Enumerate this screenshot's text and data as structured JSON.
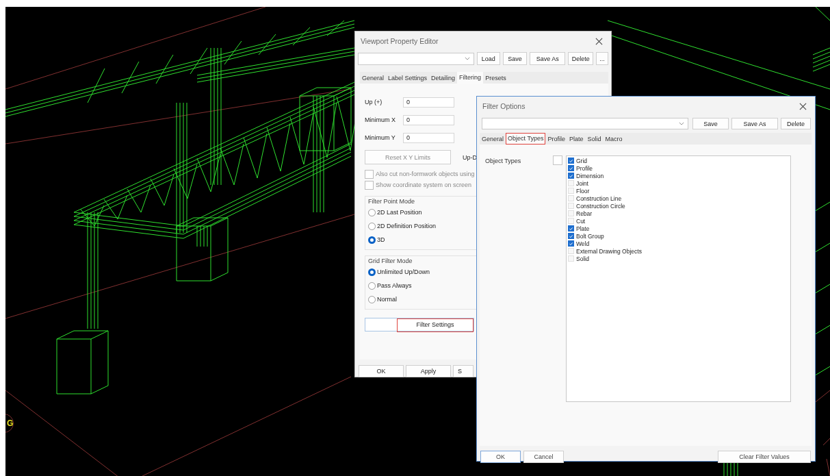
{
  "grid_label": "G",
  "viewport_editor": {
    "title": "Viewport Property Editor",
    "buttons": [
      "Load",
      "Save",
      "Save As",
      "Delete",
      "..."
    ],
    "tabs": [
      {
        "label": "General",
        "selected": false
      },
      {
        "label": "Label Settings",
        "selected": false
      },
      {
        "label": "Detailing",
        "selected": false
      },
      {
        "label": "Filtering",
        "selected": true
      },
      {
        "label": "Presets",
        "selected": false
      }
    ],
    "fields": [
      {
        "label": "Up (+)",
        "value": "0"
      },
      {
        "label": "Minimum X",
        "value": "0"
      },
      {
        "label": "Minimum Y",
        "value": "0"
      }
    ],
    "reset_button": {
      "label": "Reset X Y Limits",
      "disabled": true
    },
    "up_down_label": "Up-D",
    "checkboxes": [
      {
        "label": "Also cut non-formwork objects using",
        "checked": false,
        "disabled": true
      },
      {
        "label": "Show coordinate system on screen",
        "checked": false,
        "disabled": true
      }
    ],
    "groups": [
      {
        "title": "Filter Point Mode",
        "options": [
          {
            "label": "2D Last Position",
            "selected": false
          },
          {
            "label": "2D Definition Position",
            "selected": false
          },
          {
            "label": "3D",
            "selected": true
          }
        ]
      },
      {
        "title": "Grid Filter Mode",
        "options": [
          {
            "label": "Unlimited Up/Down",
            "selected": true
          },
          {
            "label": "Pass Always",
            "selected": false
          },
          {
            "label": "Normal",
            "selected": false
          }
        ]
      }
    ],
    "filter_settings_button": {
      "label": "Filter Settings",
      "highlighted": true
    },
    "footer_buttons": [
      "OK",
      "Apply",
      "S"
    ]
  },
  "filter_options": {
    "title": "Filter Options",
    "buttons": [
      "Save",
      "Save As",
      "Delete"
    ],
    "tabs": [
      {
        "label": "General",
        "selected": false,
        "highlighted": false
      },
      {
        "label": "Object Types",
        "selected": true,
        "highlighted": true
      },
      {
        "label": "Profile",
        "selected": false,
        "highlighted": false
      },
      {
        "label": "Plate",
        "selected": false,
        "highlighted": false
      },
      {
        "label": "Solid",
        "selected": false,
        "highlighted": false
      },
      {
        "label": "Macro",
        "selected": false,
        "highlighted": false
      }
    ],
    "object_types_label": "Object Types",
    "select_all_checked": false,
    "object_types": [
      {
        "label": "Grid",
        "checked": true
      },
      {
        "label": "Profile",
        "checked": true
      },
      {
        "label": "Dimension",
        "checked": true
      },
      {
        "label": "Joint",
        "checked": false
      },
      {
        "label": "Floor",
        "checked": false
      },
      {
        "label": "Construction Line",
        "checked": false
      },
      {
        "label": "Construction Circle",
        "checked": false
      },
      {
        "label": "Rebar",
        "checked": false
      },
      {
        "label": "Cut",
        "checked": false
      },
      {
        "label": "Plate",
        "checked": true
      },
      {
        "label": "Bolt Group",
        "checked": true
      },
      {
        "label": "Weld",
        "checked": true
      },
      {
        "label": "External Drawing Objects",
        "checked": false
      },
      {
        "label": "Solid",
        "checked": false
      }
    ],
    "footer_buttons": [
      {
        "label": "OK",
        "focused": true
      },
      {
        "label": "Cancel",
        "focused": false
      }
    ],
    "clear_button": "Clear Filter Values"
  }
}
